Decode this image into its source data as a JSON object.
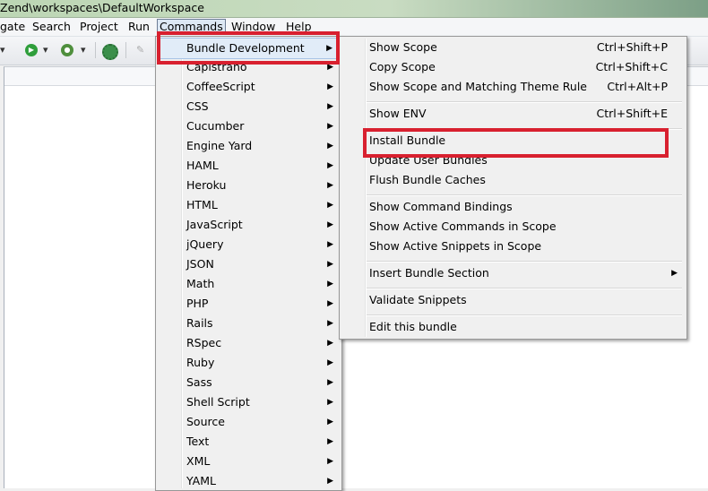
{
  "window": {
    "title": "Zend\\workspaces\\DefaultWorkspace"
  },
  "menubar": {
    "items": [
      {
        "label": "gate"
      },
      {
        "label": "Search"
      },
      {
        "label": "Project"
      },
      {
        "label": "Run"
      },
      {
        "label": "Commands"
      },
      {
        "label": "Window"
      },
      {
        "label": "Help"
      }
    ]
  },
  "commands_menu": {
    "items": [
      {
        "label": "Bundle Development"
      },
      {
        "label": "Capistrano"
      },
      {
        "label": "CoffeeScript"
      },
      {
        "label": "CSS"
      },
      {
        "label": "Cucumber"
      },
      {
        "label": "Engine Yard"
      },
      {
        "label": "HAML"
      },
      {
        "label": "Heroku"
      },
      {
        "label": "HTML"
      },
      {
        "label": "JavaScript"
      },
      {
        "label": "jQuery"
      },
      {
        "label": "JSON"
      },
      {
        "label": "Math"
      },
      {
        "label": "PHP"
      },
      {
        "label": "Rails"
      },
      {
        "label": "RSpec"
      },
      {
        "label": "Ruby"
      },
      {
        "label": "Sass"
      },
      {
        "label": "Shell Script"
      },
      {
        "label": "Source"
      },
      {
        "label": "Text"
      },
      {
        "label": "XML"
      },
      {
        "label": "YAML"
      }
    ]
  },
  "submenu": {
    "items": [
      {
        "label": "Show Scope",
        "shortcut": "Ctrl+Shift+P"
      },
      {
        "label": "Copy Scope",
        "shortcut": "Ctrl+Shift+C"
      },
      {
        "label": "Show Scope and Matching Theme Rule",
        "shortcut": "Ctrl+Alt+P"
      },
      {
        "label": "Show ENV",
        "shortcut": "Ctrl+Shift+E"
      },
      {
        "label": "Install Bundle"
      },
      {
        "label": "Update User Bundles"
      },
      {
        "label": "Flush Bundle Caches"
      },
      {
        "label": "Show Command Bindings"
      },
      {
        "label": "Show Active Commands in Scope"
      },
      {
        "label": "Show Active Snippets in Scope"
      },
      {
        "label": "Insert Bundle Section"
      },
      {
        "label": "Validate Snippets"
      },
      {
        "label": "Edit this bundle"
      }
    ]
  },
  "colors": {
    "highlight": "#d8202f",
    "menu_hover": "#e1ecf8"
  }
}
